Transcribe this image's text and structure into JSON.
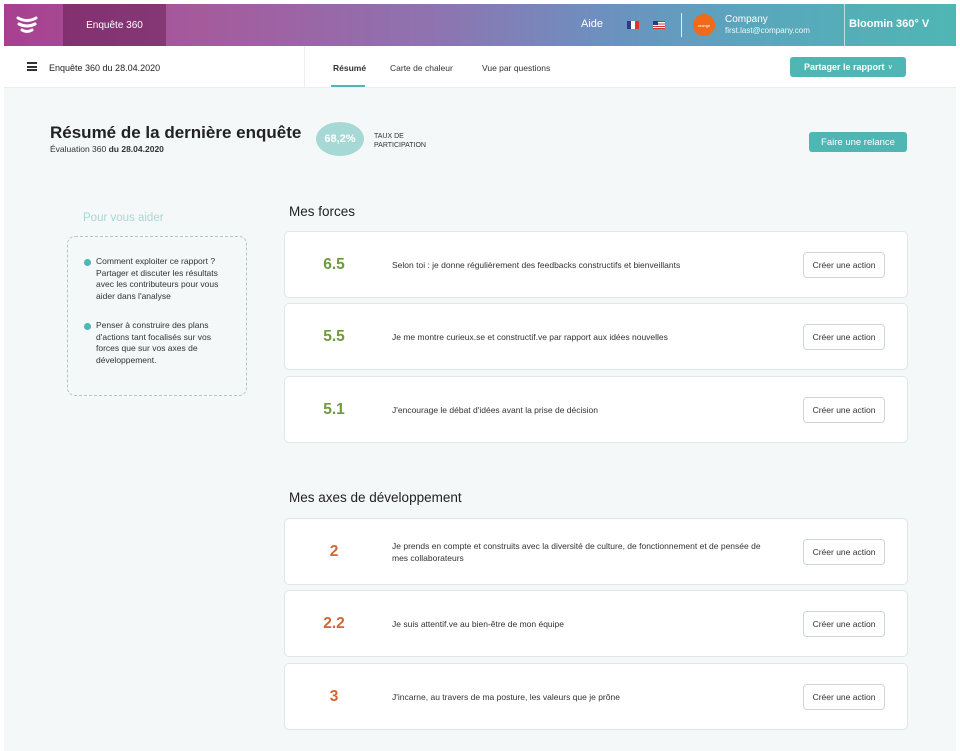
{
  "topbar": {
    "app_name": "Enquête 360",
    "help": "Aide",
    "company": {
      "name": "Company",
      "email": "first.last@company.com",
      "logo_text": "orange"
    },
    "brand_menu": "Bloomin 360°  V"
  },
  "subbar": {
    "survey_title": "Enquête 360 du 28.04.2020",
    "tabs": [
      "Résumé",
      "Carte de chaleur",
      "Vue par questions"
    ],
    "share_button": "Partager le rapport",
    "share_chevron": "v"
  },
  "summary": {
    "title": "Résumé de la dernière enquête",
    "subtitle_prefix": "Évaluation 360 ",
    "subtitle_date": "du 28.04.2020",
    "participation_rate": "68,2%",
    "participation_label": "TAUX DE PARTICIPATION",
    "relance_button": "Faire une relance"
  },
  "help": {
    "title": "Pour vous aider",
    "items": [
      "Comment exploiter ce rapport ? Partager et discuter les résultats avec les contributeurs pour vous aider dans l'analyse",
      "Penser à construire des plans d'actions tant focalisés sur vos forces que sur vos axes de développement."
    ]
  },
  "strengths": {
    "title": "Mes forces",
    "items": [
      {
        "score": "6.5",
        "text": "Selon toi : je donne régulièrement des feedbacks constructifs et bienveillants",
        "action": "Créer une action"
      },
      {
        "score": "5.5",
        "text": "Je me montre curieux.se et constructif.ve par rapport aux idées nouvelles",
        "action": "Créer une action"
      },
      {
        "score": "5.1",
        "text": "J'encourage le débat d'idées avant la prise de décision",
        "action": "Créer une action"
      }
    ]
  },
  "development": {
    "title": "Mes axes de développement",
    "items": [
      {
        "score": "2",
        "text": "Je prends en compte et construits avec la diversité de culture, de fonctionnement et de pensée de mes collaborateurs",
        "action": "Créer une action"
      },
      {
        "score": "2.2",
        "text": "Je suis attentif.ve au bien-être de mon équipe",
        "action": "Créer une action"
      },
      {
        "score": "3",
        "text": "J'incarne, au travers de ma posture, les valeurs que je prône",
        "action": "Créer une action"
      }
    ]
  },
  "colors": {
    "accent": "#4fb6b3",
    "good": "#6e9a3c",
    "bad": "#d56631"
  }
}
